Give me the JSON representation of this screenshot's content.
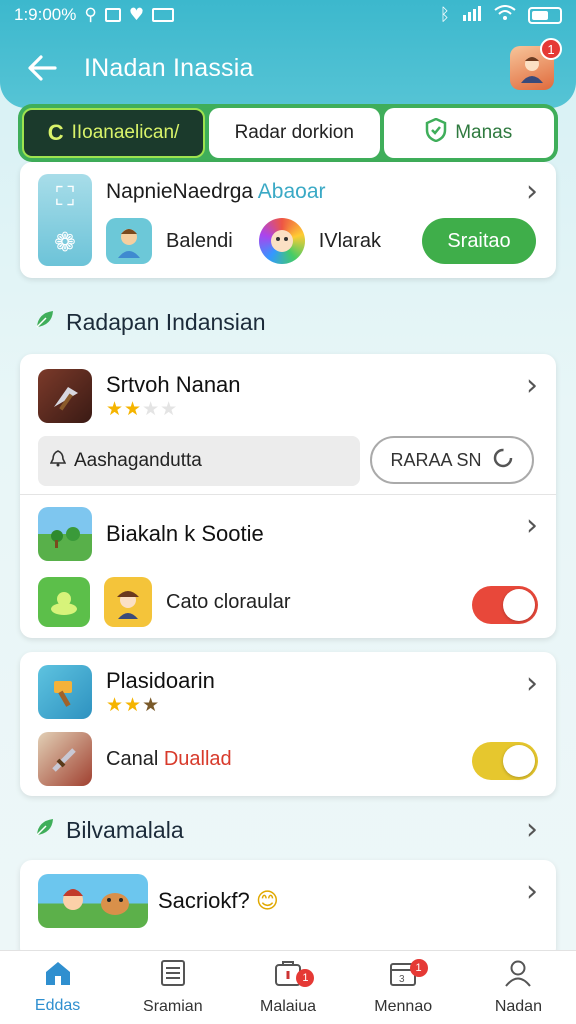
{
  "status_bar": {
    "time": "1:9:00%",
    "icons_left": [
      "usb-icon",
      "image-icon",
      "v-icon",
      "id-icon"
    ],
    "icons_right": [
      "bluetooth-icon",
      "signal-icon",
      "wifi-icon",
      "battery-icon"
    ]
  },
  "header": {
    "title": "INadan Inassia",
    "avatar_badge": "1"
  },
  "tabs": [
    {
      "label": "IIoanaelican/",
      "icon": "C",
      "active": true
    },
    {
      "label": "Radar dorkion",
      "icon": "",
      "active": false
    },
    {
      "label": "Manas",
      "icon": "⬢",
      "active": false
    }
  ],
  "card1": {
    "title": "NapnieNaedrga",
    "title_accent": "Abaoar",
    "item1": "Balendi",
    "item2": "IVlarak",
    "button": "Sraitao"
  },
  "section1": {
    "title": "Radapan Indansian"
  },
  "card2": {
    "item1": {
      "name": "Srtvoh Nanan",
      "rating": 2
    },
    "search": {
      "placeholder": "Aashagandutta"
    },
    "button": "RARAA SN",
    "item2": {
      "name": "Biakaln k Sootie"
    },
    "item3": {
      "label": "Cato cloraular",
      "toggle_on": true,
      "toggle_color": "#e8483a"
    }
  },
  "card3": {
    "item1": {
      "name": "Plasidoarin",
      "rating": 3
    },
    "item2": {
      "label_plain": "Canal",
      "label_red": "Duallad",
      "toggle_on": true,
      "toggle_color": "#e6c72e"
    }
  },
  "section2": {
    "title": "Bilvamalala"
  },
  "card4": {
    "item1": {
      "name": "Sacriokf?",
      "emoji": "😊"
    }
  },
  "bottom_nav": [
    {
      "label": "Eddas",
      "icon": "home-icon",
      "active": true,
      "badge": ""
    },
    {
      "label": "Sramian",
      "icon": "list-icon",
      "active": false,
      "badge": ""
    },
    {
      "label": "Malaiua",
      "icon": "bag-icon",
      "active": false,
      "badge": "1"
    },
    {
      "label": "Mennao",
      "icon": "calendar-icon",
      "active": false,
      "badge": "1"
    },
    {
      "label": "Nadan",
      "icon": "user-icon",
      "active": false,
      "badge": ""
    }
  ]
}
